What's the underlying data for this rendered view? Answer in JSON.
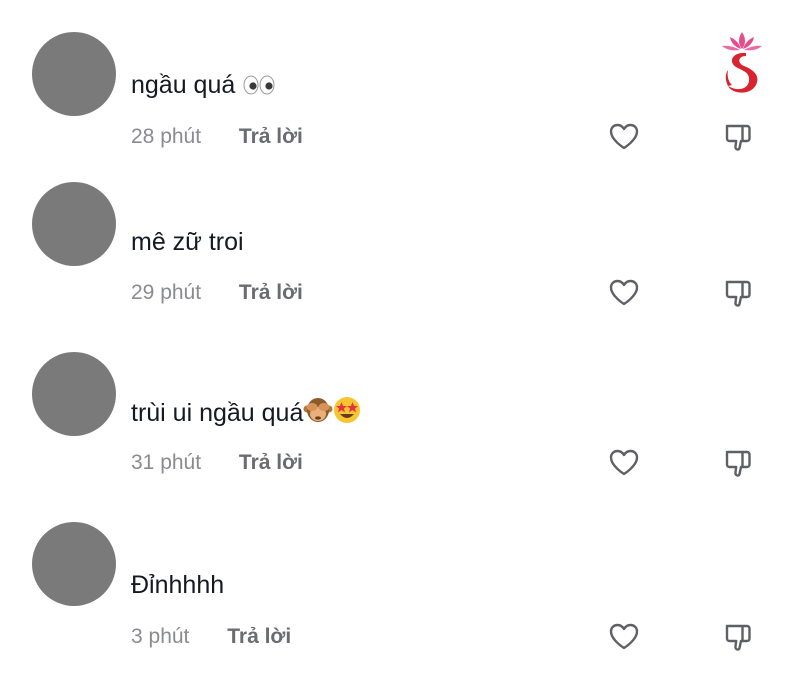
{
  "comments": [
    {
      "text": "ngầu quá",
      "emoji_names": [
        "eyes-emoji"
      ],
      "time": "28 phút",
      "reply_label": "Trả lời"
    },
    {
      "text": "mê zữ troi",
      "emoji_names": [],
      "time": "29 phút",
      "reply_label": "Trả lời"
    },
    {
      "text": "trùi ui ngầu quá",
      "emoji_names": [
        "see-no-evil-monkey-emoji",
        "star-struck-emoji"
      ],
      "time": "31 phút",
      "reply_label": "Trả lời"
    },
    {
      "text": "Đỉnhhhh",
      "emoji_names": [],
      "time": "3 phút",
      "reply_label": "Trả lời"
    }
  ],
  "icons": {
    "like": "heart-outline-icon",
    "dislike": "thumbs-down-outline-icon"
  },
  "colors": {
    "avatar": "#7a7a7a",
    "text": "#161823",
    "time": "#8a8b91",
    "reply": "#6b6c72",
    "icon": "#5f6066",
    "logo_red": "#d8242f",
    "logo_pink": "#e64d8f"
  }
}
